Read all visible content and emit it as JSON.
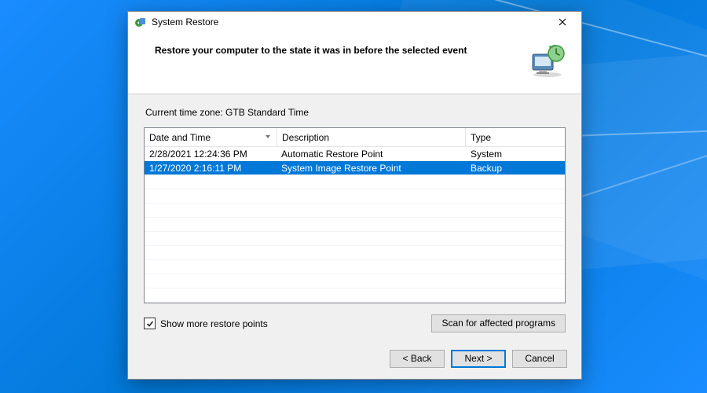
{
  "window": {
    "title": "System Restore"
  },
  "header": {
    "heading": "Restore your computer to the state it was in before the selected event"
  },
  "timezone_label": "Current time zone: GTB Standard Time",
  "columns": {
    "date": "Date and Time",
    "desc": "Description",
    "type": "Type"
  },
  "rows": [
    {
      "date": "2/28/2021 12:24:36 PM",
      "desc": "Automatic Restore Point",
      "type": "System",
      "selected": false
    },
    {
      "date": "1/27/2020 2:16:11 PM",
      "desc": "System Image Restore Point",
      "type": "Backup",
      "selected": true
    }
  ],
  "checkbox": {
    "label": "Show more restore points",
    "checked": true
  },
  "buttons": {
    "scan": "Scan for affected programs",
    "back": "< Back",
    "next": "Next >",
    "cancel": "Cancel"
  }
}
